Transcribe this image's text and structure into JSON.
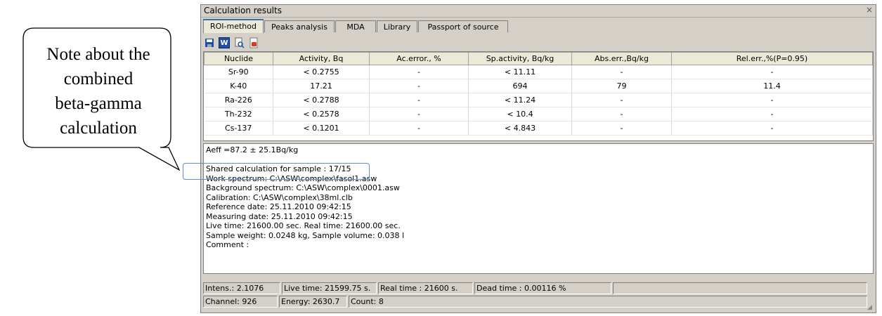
{
  "callout": {
    "lines": [
      "Note about the",
      "combined",
      "beta-gamma",
      "calculation"
    ]
  },
  "window": {
    "title": "Calculation results",
    "close": "×"
  },
  "tabs": [
    {
      "label": "ROI-method",
      "active": true
    },
    {
      "label": "Peaks analysis",
      "active": false
    },
    {
      "label": "MDA",
      "active": false
    },
    {
      "label": "Library",
      "active": false
    },
    {
      "label": "Passport of source",
      "active": false
    }
  ],
  "toolbar": {
    "icons": [
      "save-icon",
      "word-export-icon",
      "print-preview-icon",
      "pdf-export-icon"
    ],
    "word_glyph": "W"
  },
  "table": {
    "headers": [
      "Nuclide",
      "Activity, Bq",
      "Ac.error., %",
      "Sp.activity, Bq/kg",
      "Abs.err.,Bq/kg",
      "Rel.err.,%(P=0.95)"
    ],
    "rows": [
      [
        "Sr-90",
        "< 0.2755",
        "-",
        "< 11.11",
        "-",
        "-"
      ],
      [
        "K-40",
        "17.21",
        "-",
        "694",
        "79",
        "11.4"
      ],
      [
        "Ra-226",
        "< 0.2788",
        "-",
        "< 11.24",
        "-",
        "-"
      ],
      [
        "Th-232",
        "< 0.2578",
        "-",
        "< 10.4",
        "-",
        "-"
      ],
      [
        "Cs-137",
        "< 0.1201",
        "-",
        "< 4.843",
        "-",
        "-"
      ]
    ]
  },
  "log": {
    "lines": [
      "Aeff =87.2 ± 25.1Bq/kg",
      "",
      "Shared calculation for sample : 17/15",
      "Work spectrum:  C:\\ASW\\complex\\fasol1.asw",
      "Background spectrum:  C:\\ASW\\complex\\0001.asw",
      "Calibration:  C:\\ASW\\complex\\38ml.clb",
      "Reference date: 25.11.2010  09:42:15",
      "Measuring date: 25.11.2010  09:42:15",
      "Live time: 21600.00 sec. Real time: 21600.00 sec.",
      "Sample weight: 0.0248 kg,  Sample volume: 0.038 l",
      "Comment :"
    ]
  },
  "status": {
    "row1": [
      "Intens.: 2.1076",
      "Live time: 21599.75 s.",
      "Real time : 21600 s.",
      "Dead time :  0.00116 %",
      ""
    ],
    "row2": [
      "Channel:  926",
      "Energy:  2630.7",
      "Count: 8"
    ]
  },
  "colors": {
    "window_bg": "#d4d0c8",
    "highlight_box": "#5b8fd6",
    "tab_accent": "#3a6ea5"
  }
}
